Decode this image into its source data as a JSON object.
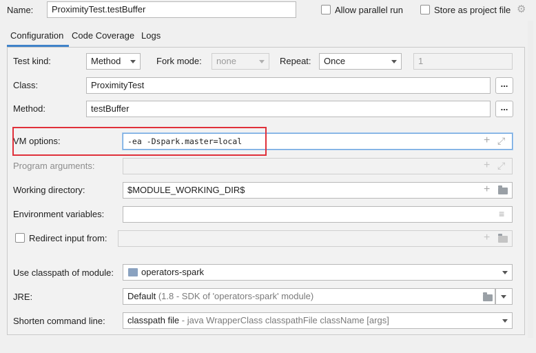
{
  "name": {
    "label": "Name:",
    "value": "ProximityTest.testBuffer"
  },
  "header_options": {
    "allow_parallel_run": "Allow parallel run",
    "store_as_project_file": "Store as project file"
  },
  "tabs": [
    "Configuration",
    "Code Coverage",
    "Logs"
  ],
  "config": {
    "test_kind": {
      "label": "Test kind:",
      "value": "Method"
    },
    "fork_mode": {
      "label": "Fork mode:",
      "value": "none"
    },
    "repeat": {
      "label": "Repeat:",
      "value": "Once",
      "count": "1"
    },
    "class": {
      "label": "Class:",
      "value": "ProximityTest",
      "button": "..."
    },
    "method": {
      "label": "Method:",
      "value": "testBuffer",
      "button": "..."
    },
    "vm_options": {
      "label": "VM options:",
      "value": "-ea -Dspark.master=local"
    },
    "program_arguments": {
      "label": "Program arguments:",
      "value": ""
    },
    "working_directory": {
      "label": "Working directory:",
      "value": "$MODULE_WORKING_DIR$"
    },
    "environment_variables": {
      "label": "Environment variables:",
      "value": ""
    },
    "redirect_input": {
      "label": "Redirect input from:",
      "value": ""
    },
    "classpath_module": {
      "label": "Use classpath of module:",
      "value": "operators-spark"
    },
    "jre": {
      "label": "JRE:",
      "value": "Default",
      "hint": "(1.8 - SDK of 'operators-spark' module)"
    },
    "shorten_command_line": {
      "label": "Shorten command line:",
      "value": "classpath file",
      "hint": "- java WrapperClass classpathFile className [args]"
    }
  },
  "icons": {
    "plus": "+",
    "expand": "⤢",
    "gear": "⚙",
    "browse": "≡"
  },
  "colors": {
    "highlight_box": "#e0303a",
    "tab_underline": "#4083c9",
    "focus_border": "#6aa3de"
  }
}
